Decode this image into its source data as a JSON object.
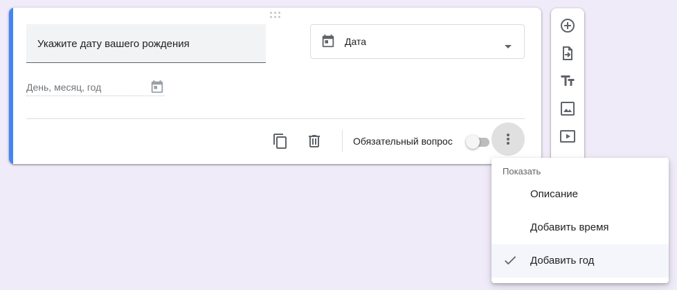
{
  "question": {
    "title": "Укажите дату вашего рождения",
    "type_label": "Дата",
    "date_placeholder": "День, месяц, год"
  },
  "footer": {
    "required_label": "Обязательный вопрос",
    "required_on": false
  },
  "side_toolbar": {
    "tools": [
      "add-question-icon",
      "import-questions-icon",
      "add-title-icon",
      "add-image-icon",
      "add-video-icon"
    ]
  },
  "menu": {
    "header": "Показать",
    "items": [
      {
        "label": "Описание",
        "checked": false
      },
      {
        "label": "Добавить время",
        "checked": false
      },
      {
        "label": "Добавить год",
        "checked": true
      }
    ]
  },
  "colors": {
    "accent": "#4285f4",
    "background": "#f0ebf8"
  }
}
